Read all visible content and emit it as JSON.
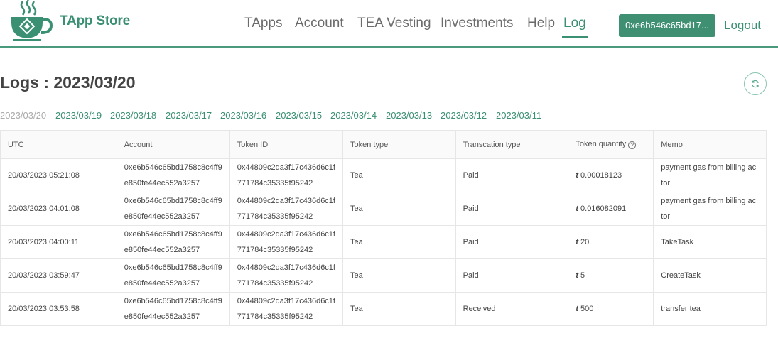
{
  "header": {
    "brand": "TApp Store",
    "nav": [
      "TApps",
      "Account",
      "TEA Vesting",
      "Investments",
      "Help",
      "Log"
    ],
    "active_nav": "Log",
    "address_label": "0xe6b546c65bd17...",
    "logout_label": "Logout",
    "accent_color": "#3b8f72"
  },
  "page": {
    "title": "Logs : 2023/03/20",
    "refresh_icon": "refresh-icon"
  },
  "dates": {
    "current": "2023/03/20",
    "links": [
      "2023/03/19",
      "2023/03/18",
      "2023/03/17",
      "2023/03/16",
      "2023/03/15",
      "2023/03/14",
      "2023/03/13",
      "2023/03/12",
      "2023/03/11"
    ]
  },
  "table": {
    "columns": [
      "UTC",
      "Account",
      "Token ID",
      "Token type",
      "Transcation type",
      "Token quantity",
      "Memo"
    ],
    "currency_symbol": "t",
    "rows": [
      {
        "utc": "20/03/2023 05:21:08",
        "account_1": "0xe6b546c65bd1758c8c4ff9",
        "account_2": "e850fe44ec552a3257",
        "token_1": "0x44809c2da3f17c436d6c1f",
        "token_2": "771784c35335f95242",
        "token_type": "Tea",
        "tx_type": "Paid",
        "quantity": "0.00018123",
        "memo_1": "payment gas from billing ac",
        "memo_2": "tor"
      },
      {
        "utc": "20/03/2023 04:01:08",
        "account_1": "0xe6b546c65bd1758c8c4ff9",
        "account_2": "e850fe44ec552a3257",
        "token_1": "0x44809c2da3f17c436d6c1f",
        "token_2": "771784c35335f95242",
        "token_type": "Tea",
        "tx_type": "Paid",
        "quantity": "0.016082091",
        "memo_1": "payment gas from billing ac",
        "memo_2": "tor"
      },
      {
        "utc": "20/03/2023 04:00:11",
        "account_1": "0xe6b546c65bd1758c8c4ff9",
        "account_2": "e850fe44ec552a3257",
        "token_1": "0x44809c2da3f17c436d6c1f",
        "token_2": "771784c35335f95242",
        "token_type": "Tea",
        "tx_type": "Paid",
        "quantity": "20",
        "memo_1": "TakeTask",
        "memo_2": ""
      },
      {
        "utc": "20/03/2023 03:59:47",
        "account_1": "0xe6b546c65bd1758c8c4ff9",
        "account_2": "e850fe44ec552a3257",
        "token_1": "0x44809c2da3f17c436d6c1f",
        "token_2": "771784c35335f95242",
        "token_type": "Tea",
        "tx_type": "Paid",
        "quantity": "5",
        "memo_1": "CreateTask",
        "memo_2": ""
      },
      {
        "utc": "20/03/2023 03:53:58",
        "account_1": "0xe6b546c65bd1758c8c4ff9",
        "account_2": "e850fe44ec552a3257",
        "token_1": "0x44809c2da3f17c436d6c1f",
        "token_2": "771784c35335f95242",
        "token_type": "Tea",
        "tx_type": "Received",
        "quantity": "500",
        "memo_1": "transfer tea",
        "memo_2": ""
      }
    ]
  }
}
